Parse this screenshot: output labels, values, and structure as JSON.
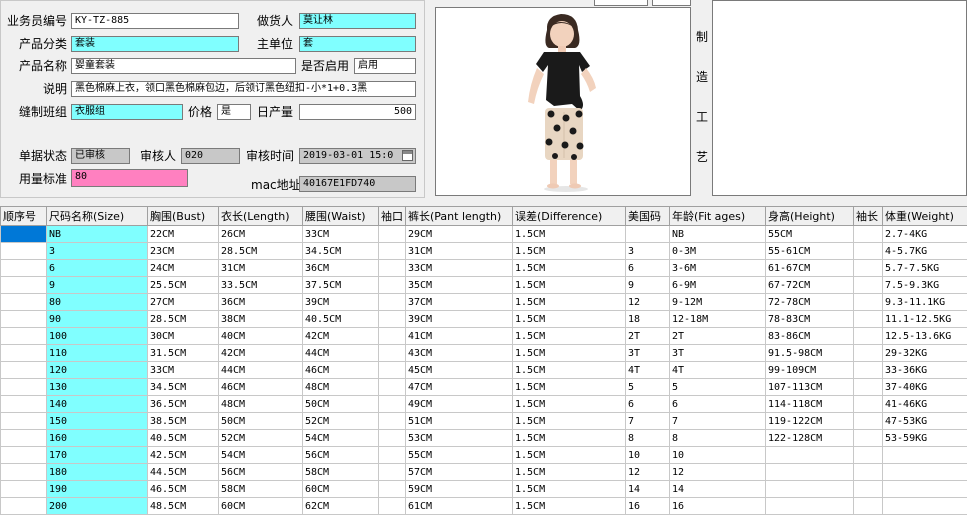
{
  "form": {
    "salesman_no_label": "业务员编号",
    "salesman_no": "KY-TZ-885",
    "supplier_label": "做货人",
    "supplier": "莫让林",
    "category_label": "产品分类",
    "category": "套装",
    "unit_label": "主单位",
    "unit": "套",
    "name_label": "产品名称",
    "name": "婴童套装",
    "enabled_label": "是否启用",
    "enabled": "启用",
    "desc_label": "说明",
    "desc": "黑色棉麻上衣，领口黑色棉麻包边，后领订黑色纽扣-小*1+0.3黑",
    "team_label": "缝制班组",
    "team": "衣服组",
    "price_label": "价格",
    "price": "是",
    "daily_label": "日产量",
    "daily": "500",
    "status_label": "单据状态",
    "status": "已审核",
    "auditor_label": "审核人",
    "auditor": "020",
    "audit_time_label": "审核时间",
    "audit_time": "2019-03-01   15:0",
    "standard_label": "用量标准",
    "standard": "80",
    "mac_label": "mac地址",
    "mac": "40167E1FD740"
  },
  "craft": {
    "c1": "制",
    "c2": "造",
    "c3": "工",
    "c4": "艺"
  },
  "colors": {
    "cyan": "#80ffff",
    "pink": "#ff80c0",
    "gray": "#c8c8c8",
    "selection": "#0078d7"
  },
  "table": {
    "headers": [
      "顺序号",
      "尺码名称(Size)",
      "胸围(Bust)",
      "衣长(Length)",
      "腰围(Waist)",
      "袖口",
      "裤长(Pant length)",
      "误差(Difference)",
      "美国码",
      "年龄(Fit ages)",
      "身高(Height)",
      "袖长",
      "体重(Weight)"
    ],
    "rows": [
      [
        "",
        "NB",
        "22CM",
        "26CM",
        "33CM",
        "",
        "29CM",
        "1.5CM",
        "",
        "NB",
        "55CM",
        "",
        "2.7-4KG"
      ],
      [
        "",
        "3",
        "23CM",
        "28.5CM",
        "34.5CM",
        "",
        "31CM",
        "1.5CM",
        "3",
        "0-3M",
        "55-61CM",
        "",
        "4-5.7KG"
      ],
      [
        "",
        "6",
        "24CM",
        "31CM",
        "36CM",
        "",
        "33CM",
        "1.5CM",
        "6",
        "3-6M",
        "61-67CM",
        "",
        "5.7-7.5KG"
      ],
      [
        "",
        "9",
        "25.5CM",
        "33.5CM",
        "37.5CM",
        "",
        "35CM",
        "1.5CM",
        "9",
        "6-9M",
        "67-72CM",
        "",
        "7.5-9.3KG"
      ],
      [
        "",
        "80",
        "27CM",
        "36CM",
        "39CM",
        "",
        "37CM",
        "1.5CM",
        "12",
        "9-12M",
        "72-78CM",
        "",
        "9.3-11.1KG"
      ],
      [
        "",
        "90",
        "28.5CM",
        "38CM",
        "40.5CM",
        "",
        "39CM",
        "1.5CM",
        "18",
        "12-18M",
        "78-83CM",
        "",
        "11.1-12.5KG"
      ],
      [
        "",
        "100",
        "30CM",
        "40CM",
        "42CM",
        "",
        "41CM",
        "1.5CM",
        "2T",
        "2T",
        "83-86CM",
        "",
        "12.5-13.6KG"
      ],
      [
        "",
        "110",
        "31.5CM",
        "42CM",
        "44CM",
        "",
        "43CM",
        "1.5CM",
        "3T",
        "3T",
        "91.5-98CM",
        "",
        "29-32KG"
      ],
      [
        "",
        "120",
        "33CM",
        "44CM",
        "46CM",
        "",
        "45CM",
        "1.5CM",
        "4T",
        "4T",
        "99-109CM",
        "",
        "33-36KG"
      ],
      [
        "",
        "130",
        "34.5CM",
        "46CM",
        "48CM",
        "",
        "47CM",
        "1.5CM",
        "5",
        "5",
        "107-113CM",
        "",
        "37-40KG"
      ],
      [
        "",
        "140",
        "36.5CM",
        "48CM",
        "50CM",
        "",
        "49CM",
        "1.5CM",
        "6",
        "6",
        "114-118CM",
        "",
        "41-46KG"
      ],
      [
        "",
        "150",
        "38.5CM",
        "50CM",
        "52CM",
        "",
        "51CM",
        "1.5CM",
        "7",
        "7",
        "119-122CM",
        "",
        "47-53KG"
      ],
      [
        "",
        "160",
        "40.5CM",
        "52CM",
        "54CM",
        "",
        "53CM",
        "1.5CM",
        "8",
        "8",
        "122-128CM",
        "",
        "53-59KG"
      ],
      [
        "",
        "170",
        "42.5CM",
        "54CM",
        "56CM",
        "",
        "55CM",
        "1.5CM",
        "10",
        "10",
        "",
        "",
        ""
      ],
      [
        "",
        "180",
        "44.5CM",
        "56CM",
        "58CM",
        "",
        "57CM",
        "1.5CM",
        "12",
        "12",
        "",
        "",
        ""
      ],
      [
        "",
        "190",
        "46.5CM",
        "58CM",
        "60CM",
        "",
        "59CM",
        "1.5CM",
        "14",
        "14",
        "",
        "",
        ""
      ],
      [
        "",
        "200",
        "48.5CM",
        "60CM",
        "62CM",
        "",
        "61CM",
        "1.5CM",
        "16",
        "16",
        "",
        "",
        ""
      ]
    ]
  }
}
